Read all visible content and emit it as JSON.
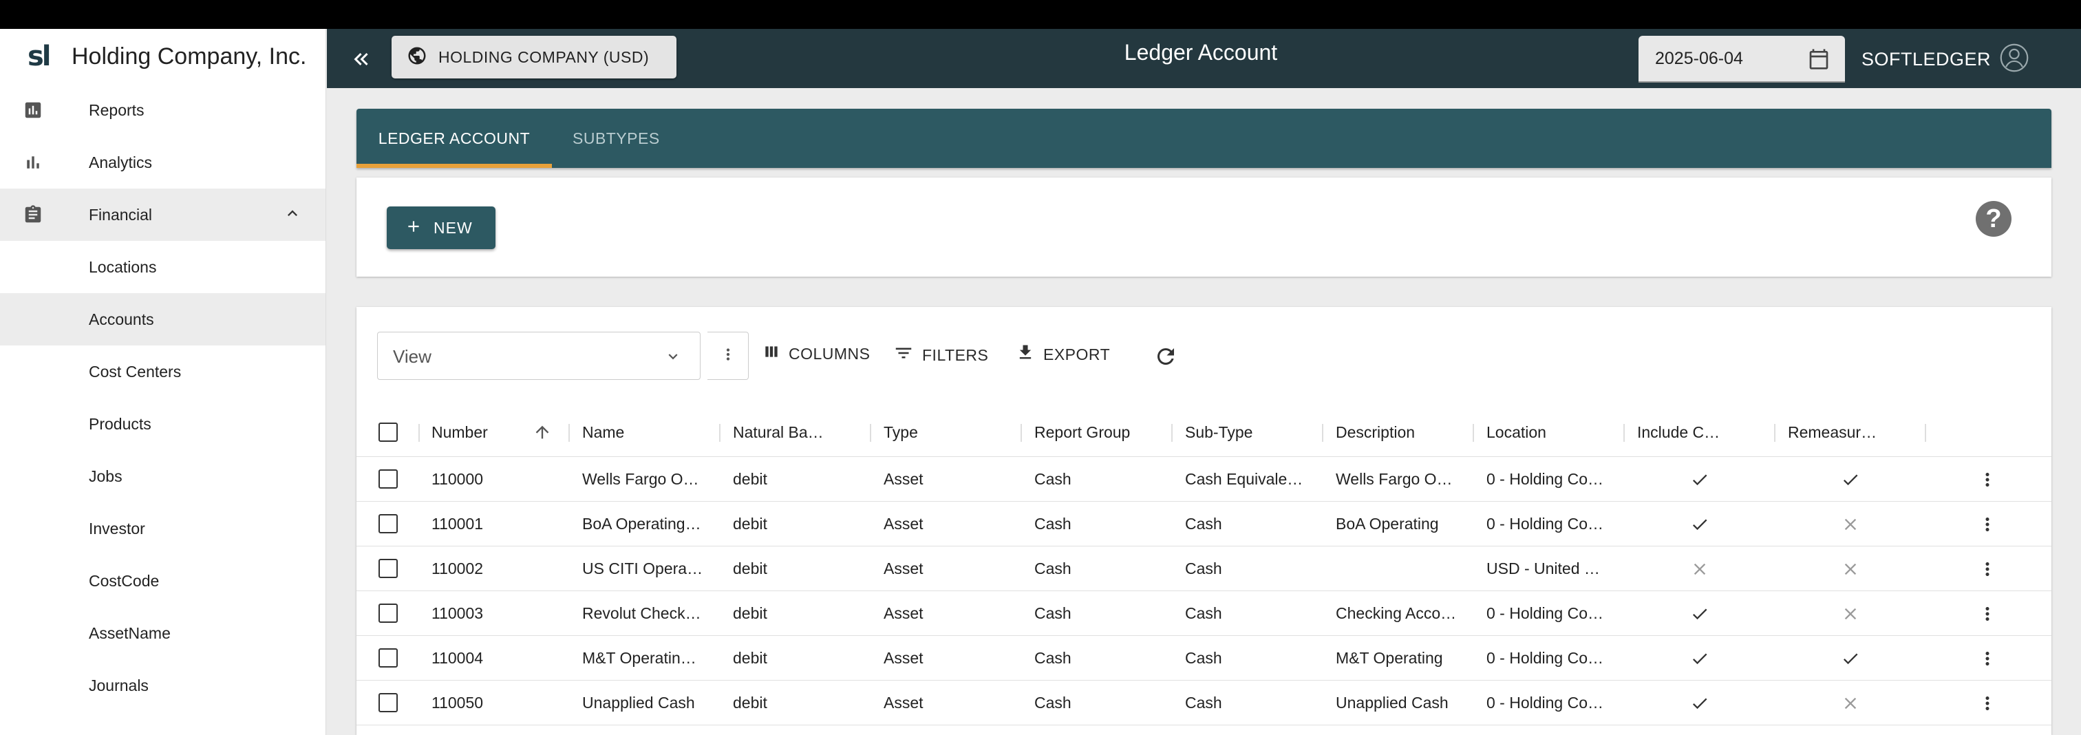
{
  "sidebar": {
    "logo_text": "sl",
    "company_name": "Holding Company, Inc.",
    "items": [
      {
        "label": "Reports",
        "icon": "reports-icon"
      },
      {
        "label": "Analytics",
        "icon": "bar-chart-icon"
      },
      {
        "label": "Financial",
        "icon": "clipboard-icon",
        "expanded": true
      },
      {
        "label": "Locations"
      },
      {
        "label": "Accounts",
        "selected": true
      },
      {
        "label": "Cost Centers"
      },
      {
        "label": "Products"
      },
      {
        "label": "Jobs"
      },
      {
        "label": "Investor"
      },
      {
        "label": "CostCode"
      },
      {
        "label": "AssetName"
      },
      {
        "label": "Journals"
      }
    ]
  },
  "header": {
    "company_button": "HOLDING COMPANY (USD)",
    "title": "Ledger Account",
    "date": "2025-06-04",
    "user": "SOFTLEDGER"
  },
  "tabs": [
    {
      "label": "LEDGER ACCOUNT",
      "active": true
    },
    {
      "label": "SUBTYPES",
      "active": false
    }
  ],
  "actions": {
    "new_label": "NEW"
  },
  "toolbar": {
    "view_placeholder": "View",
    "columns_label": "COLUMNS",
    "filters_label": "FILTERS",
    "export_label": "EXPORT"
  },
  "table": {
    "columns": [
      "Number",
      "Name",
      "Natural Ba…",
      "Type",
      "Report Group",
      "Sub-Type",
      "Description",
      "Location",
      "Include C…",
      "Remeasur…"
    ],
    "sort_column": "Number",
    "sort_direction": "ascending",
    "rows": [
      {
        "number": "110000",
        "name": "Wells Fargo O…",
        "natural_balance": "debit",
        "type": "Asset",
        "report_group": "Cash",
        "sub_type": "Cash Equivale…",
        "description": "Wells Fargo O…",
        "location": "0 - Holding Co…",
        "include": true,
        "remeasure": true
      },
      {
        "number": "110001",
        "name": "BoA Operating…",
        "natural_balance": "debit",
        "type": "Asset",
        "report_group": "Cash",
        "sub_type": "Cash",
        "description": "BoA Operating",
        "location": "0 - Holding Co…",
        "include": true,
        "remeasure": false
      },
      {
        "number": "110002",
        "name": "US CITI Opera…",
        "natural_balance": "debit",
        "type": "Asset",
        "report_group": "Cash",
        "sub_type": "Cash",
        "description": "",
        "location": "USD - United …",
        "include": false,
        "remeasure": false
      },
      {
        "number": "110003",
        "name": "Revolut Check…",
        "natural_balance": "debit",
        "type": "Asset",
        "report_group": "Cash",
        "sub_type": "Cash",
        "description": "Checking Acco…",
        "location": "0 - Holding Co…",
        "include": true,
        "remeasure": false
      },
      {
        "number": "110004",
        "name": "M&T Operatin…",
        "natural_balance": "debit",
        "type": "Asset",
        "report_group": "Cash",
        "sub_type": "Cash",
        "description": "M&T Operating",
        "location": "0 - Holding Co…",
        "include": true,
        "remeasure": true
      },
      {
        "number": "110050",
        "name": "Unapplied Cash",
        "natural_balance": "debit",
        "type": "Asset",
        "report_group": "Cash",
        "sub_type": "Cash",
        "description": "Unapplied Cash",
        "location": "0 - Holding Co…",
        "include": true,
        "remeasure": false
      }
    ]
  },
  "colors": {
    "header_bg": "#24383f",
    "tab_bg": "#2d5962",
    "tab_indicator": "#e8a13a",
    "button_bg": "#2d5962"
  }
}
